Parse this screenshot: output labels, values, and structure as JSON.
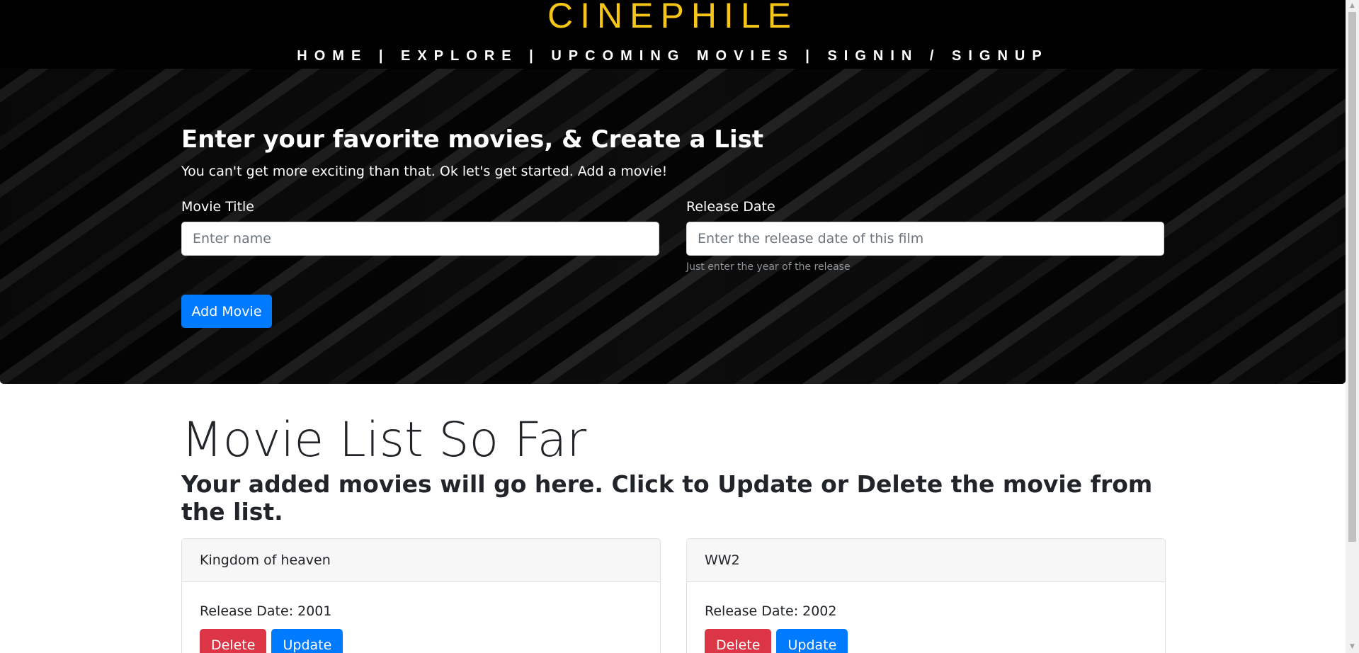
{
  "header": {
    "brand": "CINEPHILE",
    "nav": [
      {
        "label": "HOME"
      },
      {
        "label": "EXPLORE"
      },
      {
        "label": "UPCOMING MOVIES"
      },
      {
        "label": "SIGNIN / SIGNUP"
      }
    ],
    "separator": "|"
  },
  "hero": {
    "title": "Enter your favorite movies, & Create a List",
    "subtitle": "You can't get more exciting than that. Ok let's get started. Add a movie!",
    "movie_title_label": "Movie Title",
    "movie_title_placeholder": "Enter name",
    "movie_title_value": "",
    "release_date_label": "Release Date",
    "release_date_placeholder": "Enter the release date of this film",
    "release_date_value": "",
    "release_date_help": "Just enter the year of the release",
    "add_button_label": "Add Movie"
  },
  "list": {
    "title": "Movie List So Far",
    "subtitle": "Your added movies will go here. Click to Update or Delete the movie from the list.",
    "movies": [
      {
        "title": "Kingdom of heaven",
        "release_text": "Release Date: 2001",
        "delete_label": "Delete",
        "update_label": "Update"
      },
      {
        "title": "WW2",
        "release_text": "Release Date: 2002",
        "delete_label": "Delete",
        "update_label": "Update"
      }
    ]
  },
  "colors": {
    "brand": "#f5c518",
    "primary": "#007bff",
    "danger": "#dc3545",
    "header_bg": "#000000"
  }
}
